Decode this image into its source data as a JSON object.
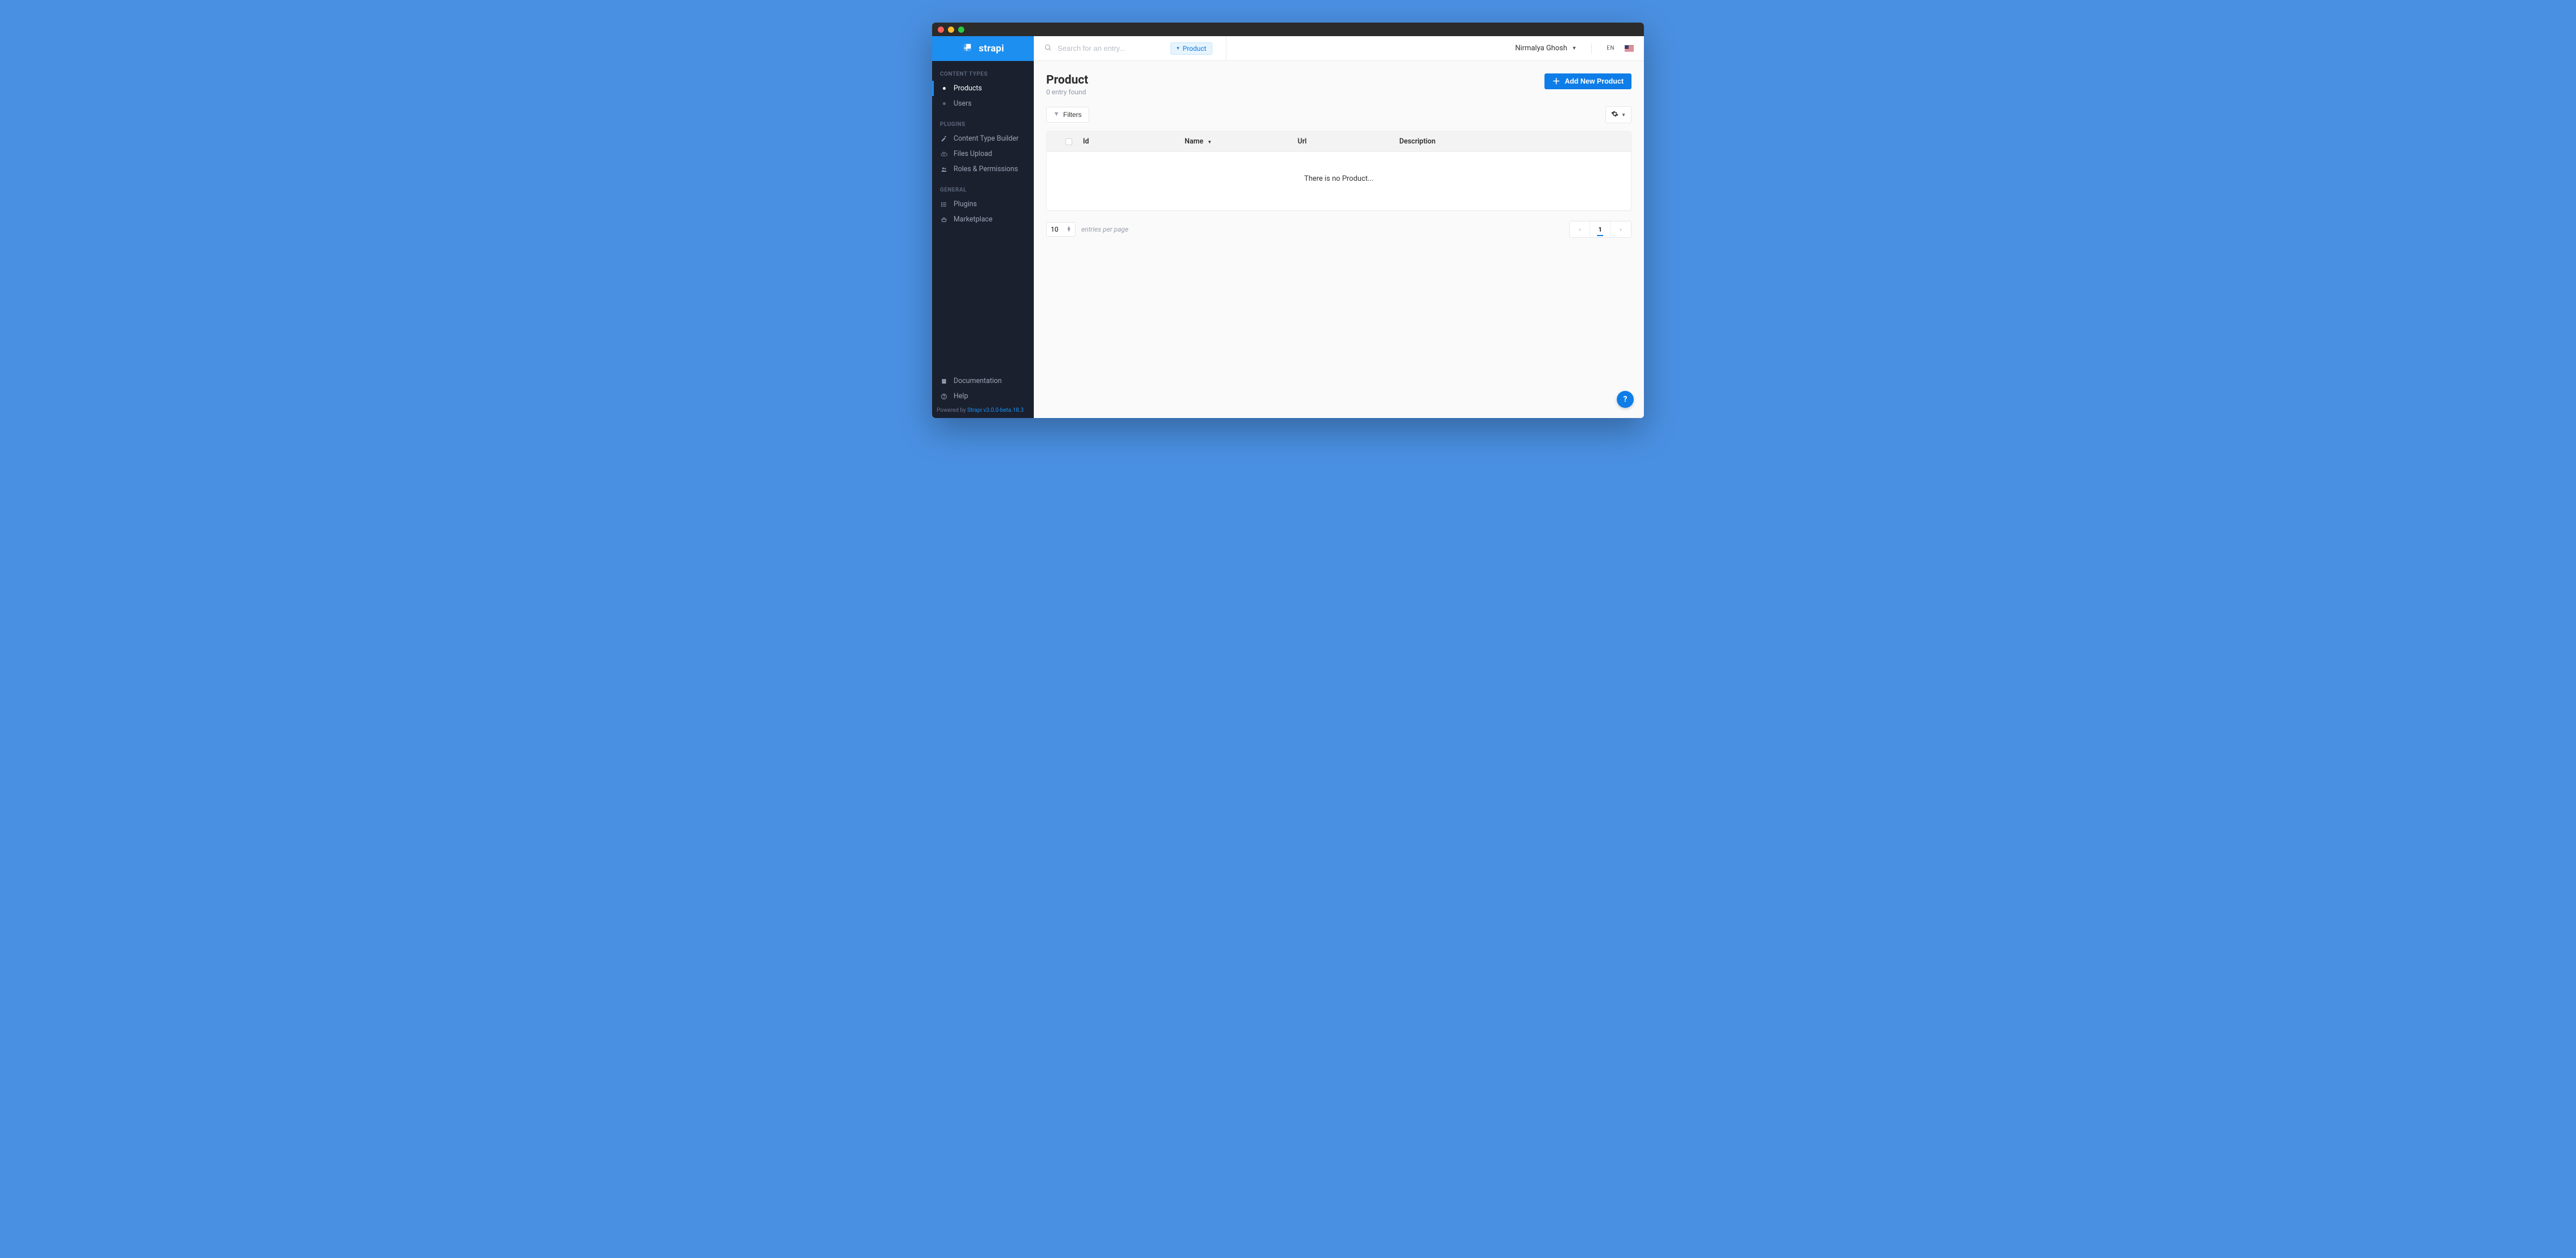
{
  "brand": {
    "name": "strapi"
  },
  "sidebar": {
    "sections": [
      {
        "heading": "CONTENT TYPES",
        "items": [
          {
            "label": "Products",
            "active": true
          },
          {
            "label": "Users",
            "active": false
          }
        ]
      },
      {
        "heading": "PLUGINS",
        "items": [
          {
            "label": "Content Type Builder"
          },
          {
            "label": "Files Upload"
          },
          {
            "label": "Roles & Permissions"
          }
        ]
      },
      {
        "heading": "GENERAL",
        "items": [
          {
            "label": "Plugins"
          },
          {
            "label": "Marketplace"
          }
        ]
      }
    ],
    "footer": [
      {
        "label": "Documentation"
      },
      {
        "label": "Help"
      }
    ],
    "powered_prefix": "Powered by ",
    "powered_link": "Strapi v3.0.0-beta.18.3"
  },
  "topbar": {
    "search_placeholder": "Search for an entry...",
    "search_filter_chip": "Product",
    "user_name": "Nirmalya Ghosh",
    "lang": "EN"
  },
  "page": {
    "title": "Product",
    "subtitle": "0 entry found",
    "add_button": "Add New Product",
    "filters_button": "Filters"
  },
  "table": {
    "columns": {
      "id": "Id",
      "name": "Name",
      "url": "Url",
      "description": "Description"
    },
    "empty_text": "There is no Product..."
  },
  "pagination": {
    "per_page_value": "10",
    "per_page_label": "entries per page",
    "current_page": "1"
  }
}
